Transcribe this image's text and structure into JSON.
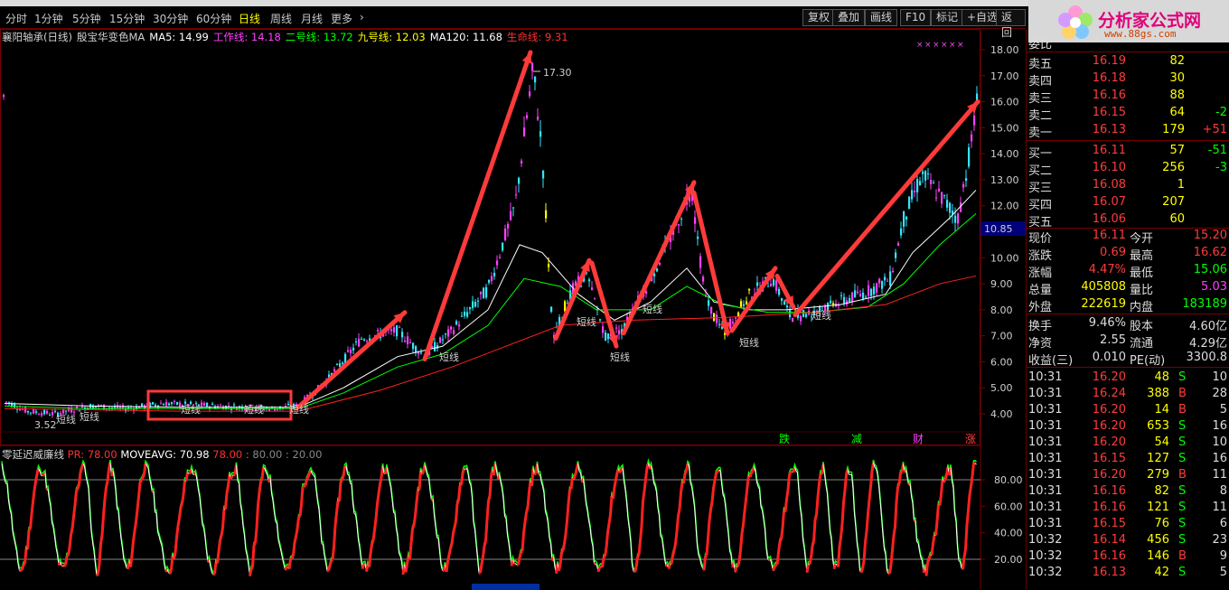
{
  "toolbar": {
    "periods": [
      "分时",
      "1分钟",
      "5分钟",
      "15分钟",
      "30分钟",
      "60分钟",
      "日线",
      "周线",
      "月线",
      "更多"
    ],
    "active": "日线",
    "buttons": [
      "复权",
      "叠加",
      "画线",
      "F10",
      "标记",
      "+自选",
      "返回"
    ]
  },
  "logo": {
    "title": "分析家公式网",
    "url": "www.88gs.com"
  },
  "info": {
    "stock": "襄阳轴承(日线)",
    "indicator": "殷宝华变色MA",
    "ma5": "MA5: 14.99",
    "work": "工作线: 14.18",
    "two": "二号线: 13.72",
    "nine": "九号线: 12.03",
    "ma120": "MA120: 11.68",
    "life": "生命线: 9.31"
  },
  "sub_info": {
    "title": "零延迟威廉线",
    "pr": "PR: 78.00",
    "moveavg": "MOVEAVG: 70.98",
    "val": "78.00",
    "levels": ": 80.00 : 20.00"
  },
  "annotations": {
    "high": "17.30",
    "low": "3.52",
    "short_label": "短线",
    "price_tag": "10.85"
  },
  "signals": [
    "跌",
    "减",
    "财",
    "涨"
  ],
  "price_axis": [
    "18.00",
    "17.00",
    "16.00",
    "15.00",
    "14.00",
    "13.00",
    "12.00",
    "11.00",
    "10.00",
    "9.00",
    "8.00",
    "7.00",
    "6.00",
    "5.00",
    "4.00"
  ],
  "sub_axis": [
    "80.00",
    "60.00",
    "40.00",
    "20.00"
  ],
  "quote": {
    "label_top": "委比",
    "asks": [
      {
        "label": "卖五",
        "price": "16.19",
        "vol": "82",
        "chg": ""
      },
      {
        "label": "卖四",
        "price": "16.18",
        "vol": "30",
        "chg": ""
      },
      {
        "label": "卖三",
        "price": "16.16",
        "vol": "88",
        "chg": ""
      },
      {
        "label": "卖二",
        "price": "16.15",
        "vol": "64",
        "chg": "-2"
      },
      {
        "label": "卖一",
        "price": "16.13",
        "vol": "179",
        "chg": "+51"
      }
    ],
    "bids": [
      {
        "label": "买一",
        "price": "16.11",
        "vol": "57",
        "chg": "-51"
      },
      {
        "label": "买二",
        "price": "16.10",
        "vol": "256",
        "chg": "-3"
      },
      {
        "label": "买三",
        "price": "16.08",
        "vol": "1",
        "chg": ""
      },
      {
        "label": "买四",
        "price": "16.07",
        "vol": "207",
        "chg": ""
      },
      {
        "label": "买五",
        "price": "16.06",
        "vol": "60",
        "chg": ""
      }
    ],
    "stats": [
      {
        "l1": "现价",
        "v1": "16.11",
        "l2": "今开",
        "v2": "15.20"
      },
      {
        "l1": "涨跌",
        "v1": "0.69",
        "l2": "最高",
        "v2": "16.62"
      },
      {
        "l1": "涨幅",
        "v1": "4.47%",
        "l2": "最低",
        "v2": "15.06"
      },
      {
        "l1": "总量",
        "v1": "405808",
        "l2": "量比",
        "v2": "5.03"
      },
      {
        "l1": "外盘",
        "v1": "222619",
        "l2": "内盘",
        "v2": "183189"
      }
    ],
    "fund": [
      {
        "l1": "换手",
        "v1": "9.46%",
        "l2": "股本",
        "v2": "4.60亿"
      },
      {
        "l1": "净资",
        "v1": "2.55",
        "l2": "流通",
        "v2": "4.29亿"
      },
      {
        "l1": "收益(三)",
        "v1": "0.010",
        "l2": "PE(动)",
        "v2": "3300.8"
      }
    ],
    "ticks": [
      {
        "t": "10:31",
        "p": "16.20",
        "v": "48",
        "s": "S",
        "n": "10"
      },
      {
        "t": "10:31",
        "p": "16.24",
        "v": "388",
        "s": "B",
        "n": "28"
      },
      {
        "t": "10:31",
        "p": "16.20",
        "v": "14",
        "s": "B",
        "n": "5"
      },
      {
        "t": "10:31",
        "p": "16.20",
        "v": "653",
        "s": "S",
        "n": "16"
      },
      {
        "t": "10:31",
        "p": "16.20",
        "v": "54",
        "s": "S",
        "n": "10"
      },
      {
        "t": "10:31",
        "p": "16.15",
        "v": "127",
        "s": "S",
        "n": "16"
      },
      {
        "t": "10:31",
        "p": "16.20",
        "v": "279",
        "s": "B",
        "n": "11"
      },
      {
        "t": "10:31",
        "p": "16.16",
        "v": "82",
        "s": "S",
        "n": "8"
      },
      {
        "t": "10:31",
        "p": "16.16",
        "v": "121",
        "s": "S",
        "n": "11"
      },
      {
        "t": "10:31",
        "p": "16.15",
        "v": "76",
        "s": "S",
        "n": "6"
      },
      {
        "t": "10:32",
        "p": "16.14",
        "v": "456",
        "s": "S",
        "n": "23"
      },
      {
        "t": "10:32",
        "p": "16.16",
        "v": "146",
        "s": "B",
        "n": "9"
      },
      {
        "t": "10:32",
        "p": "16.13",
        "v": "42",
        "s": "S",
        "n": "5"
      }
    ]
  },
  "colors": {
    "up": "#ff3b3b",
    "down": "#00ff00",
    "price": "#ff3b3b",
    "vol": "#ffff00",
    "grid": "#660000"
  }
}
